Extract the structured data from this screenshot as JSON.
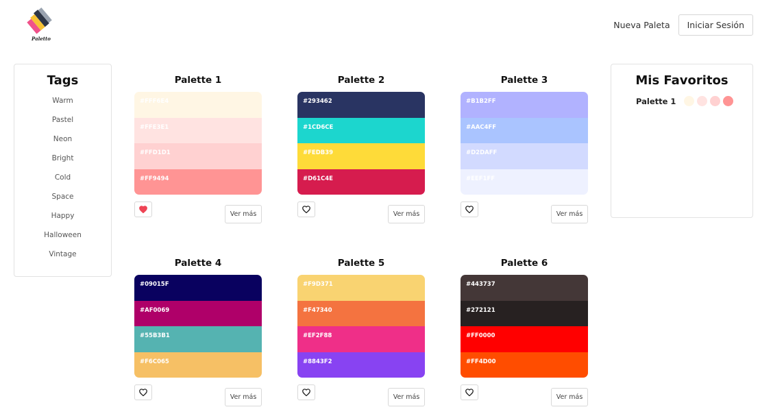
{
  "brand": {
    "name": "Paletto"
  },
  "nav": {
    "new_palette": "Nueva Paleta",
    "login": "Iniciar Sesión"
  },
  "tags": {
    "title": "Tags",
    "items": [
      "Warm",
      "Pastel",
      "Neon",
      "Bright",
      "Cold",
      "Space",
      "Happy",
      "Halloween",
      "Vintage"
    ]
  },
  "palettes": [
    {
      "title": "Palette 1",
      "favorited": true,
      "colors": [
        "#FFF6E4",
        "#FFE3E1",
        "#FFD1D1",
        "#FF9494"
      ],
      "more": "Ver más"
    },
    {
      "title": "Palette 2",
      "favorited": false,
      "colors": [
        "#293462",
        "#1CD6CE",
        "#FEDB39",
        "#D61C4E"
      ],
      "more": "Ver más"
    },
    {
      "title": "Palette 3",
      "favorited": false,
      "colors": [
        "#B1B2FF",
        "#AAC4FF",
        "#D2DAFF",
        "#EEF1FF"
      ],
      "more": "Ver más"
    },
    {
      "title": "Palette 4",
      "favorited": false,
      "colors": [
        "#09015F",
        "#AF0069",
        "#55B3B1",
        "#F6C065"
      ],
      "more": "Ver más"
    },
    {
      "title": "Palette 5",
      "favorited": false,
      "colors": [
        "#F9D371",
        "#F47340",
        "#EF2F88",
        "#8843F2"
      ],
      "more": "Ver más"
    },
    {
      "title": "Palette 6",
      "favorited": false,
      "colors": [
        "#443737",
        "#272121",
        "#FF0000",
        "#FF4D00"
      ],
      "more": "Ver más"
    }
  ],
  "favorites": {
    "title": "Mis Favoritos",
    "items": [
      {
        "name": "Palette 1",
        "colors": [
          "#FFF6E4",
          "#FFE3E1",
          "#FFD1D1",
          "#FF9494"
        ]
      }
    ]
  },
  "colors": {
    "heart_active": "#EE4455",
    "heart_inactive": "#222222"
  }
}
